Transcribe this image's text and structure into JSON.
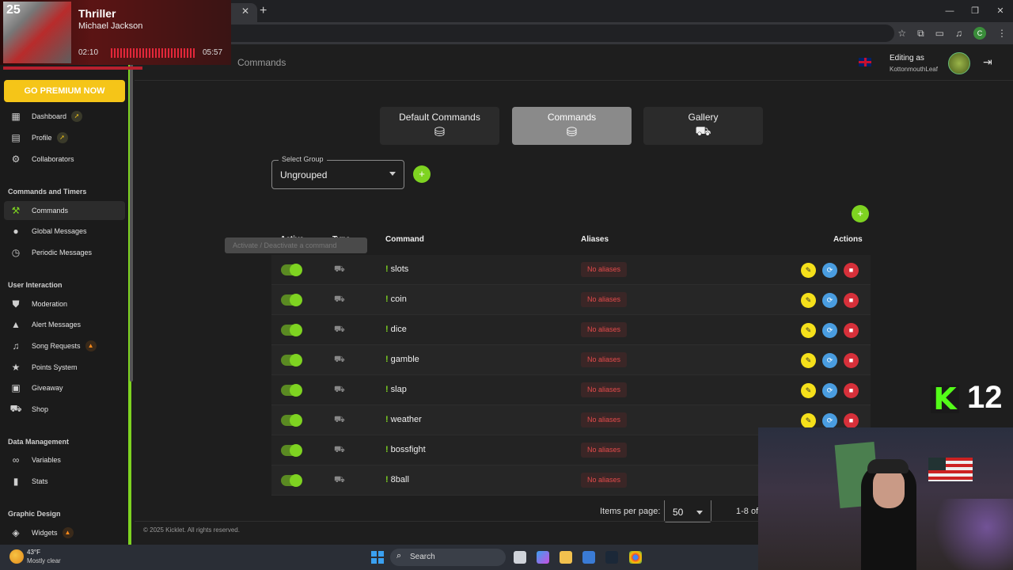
{
  "now_playing": {
    "track_number": "25",
    "title": "Thriller",
    "artist": "Michael Jackson",
    "elapsed": "02:10",
    "duration": "05:57"
  },
  "sidebar": {
    "premium_label": "GO PREMIUM NOW",
    "items": [
      {
        "label": "Dashboard",
        "icon": "dashboard-icon",
        "badge": "rocket"
      },
      {
        "label": "Profile",
        "icon": "profile-icon",
        "badge": "rocket"
      },
      {
        "label": "Collaborators",
        "icon": "collaborators-icon"
      }
    ],
    "section_commands": "Commands and Timers",
    "commands_items": [
      {
        "label": "Commands",
        "icon": "hammer-icon",
        "active": true
      },
      {
        "label": "Global Messages",
        "icon": "chat-icon"
      },
      {
        "label": "Periodic Messages",
        "icon": "clock-icon"
      }
    ],
    "section_interaction": "User Interaction",
    "interaction_items": [
      {
        "label": "Moderation",
        "icon": "shield-icon"
      },
      {
        "label": "Alert Messages",
        "icon": "warning-icon"
      },
      {
        "label": "Song Requests",
        "icon": "music-icon",
        "badge": "fire"
      },
      {
        "label": "Points System",
        "icon": "star-icon"
      },
      {
        "label": "Giveaway",
        "icon": "gift-icon"
      },
      {
        "label": "Shop",
        "icon": "cart-icon"
      }
    ],
    "section_data": "Data Management",
    "data_items": [
      {
        "label": "Variables",
        "icon": "link-icon"
      },
      {
        "label": "Stats",
        "icon": "bar-chart-icon"
      }
    ],
    "section_graphic": "Graphic Design",
    "graphic_items": [
      {
        "label": "Widgets",
        "icon": "widgets-icon",
        "badge": "fire"
      }
    ]
  },
  "header": {
    "breadcrumb": "Commands",
    "editing_label": "Editing as",
    "editing_user": "KottonmouthLeaf"
  },
  "tabs": [
    {
      "label": "Default Commands",
      "icon": "database-check-icon"
    },
    {
      "label": "Commands",
      "icon": "database-check-icon",
      "active": true
    },
    {
      "label": "Gallery",
      "icon": "cart-icon"
    }
  ],
  "group_select": {
    "label": "Select Group",
    "value": "Ungrouped"
  },
  "table": {
    "headers": {
      "active": "Active",
      "type": "Type",
      "command": "Command",
      "aliases": "Aliases",
      "actions": "Actions"
    },
    "tooltip": "Activate / Deactivate a command",
    "rows": [
      {
        "command": "slots",
        "aliases": "No aliases",
        "active": true
      },
      {
        "command": "coin",
        "aliases": "No aliases",
        "active": true
      },
      {
        "command": "dice",
        "aliases": "No aliases",
        "active": true
      },
      {
        "command": "gamble",
        "aliases": "No aliases",
        "active": true
      },
      {
        "command": "slap",
        "aliases": "No aliases",
        "active": true
      },
      {
        "command": "weather",
        "aliases": "No aliases",
        "active": true
      },
      {
        "command": "bossfight",
        "aliases": "No aliases",
        "active": true
      },
      {
        "command": "8ball",
        "aliases": "No aliases",
        "active": true
      }
    ]
  },
  "pagination": {
    "items_per_page_label": "Items per page:",
    "items_per_page": "50",
    "range": "1-8 of"
  },
  "footer": "© 2025 Kicklet. All rights reserved.",
  "kick_overlay": {
    "count": "12"
  },
  "taskbar": {
    "temperature": "43°F",
    "condition": "Mostly clear",
    "search_label": "Search"
  },
  "colors": {
    "accent": "#7ed321",
    "premium": "#f5c518",
    "alias_text": "#e44b4b",
    "edit": "#f5e01a",
    "duplicate": "#4a9de0",
    "delete": "#d6303a"
  }
}
